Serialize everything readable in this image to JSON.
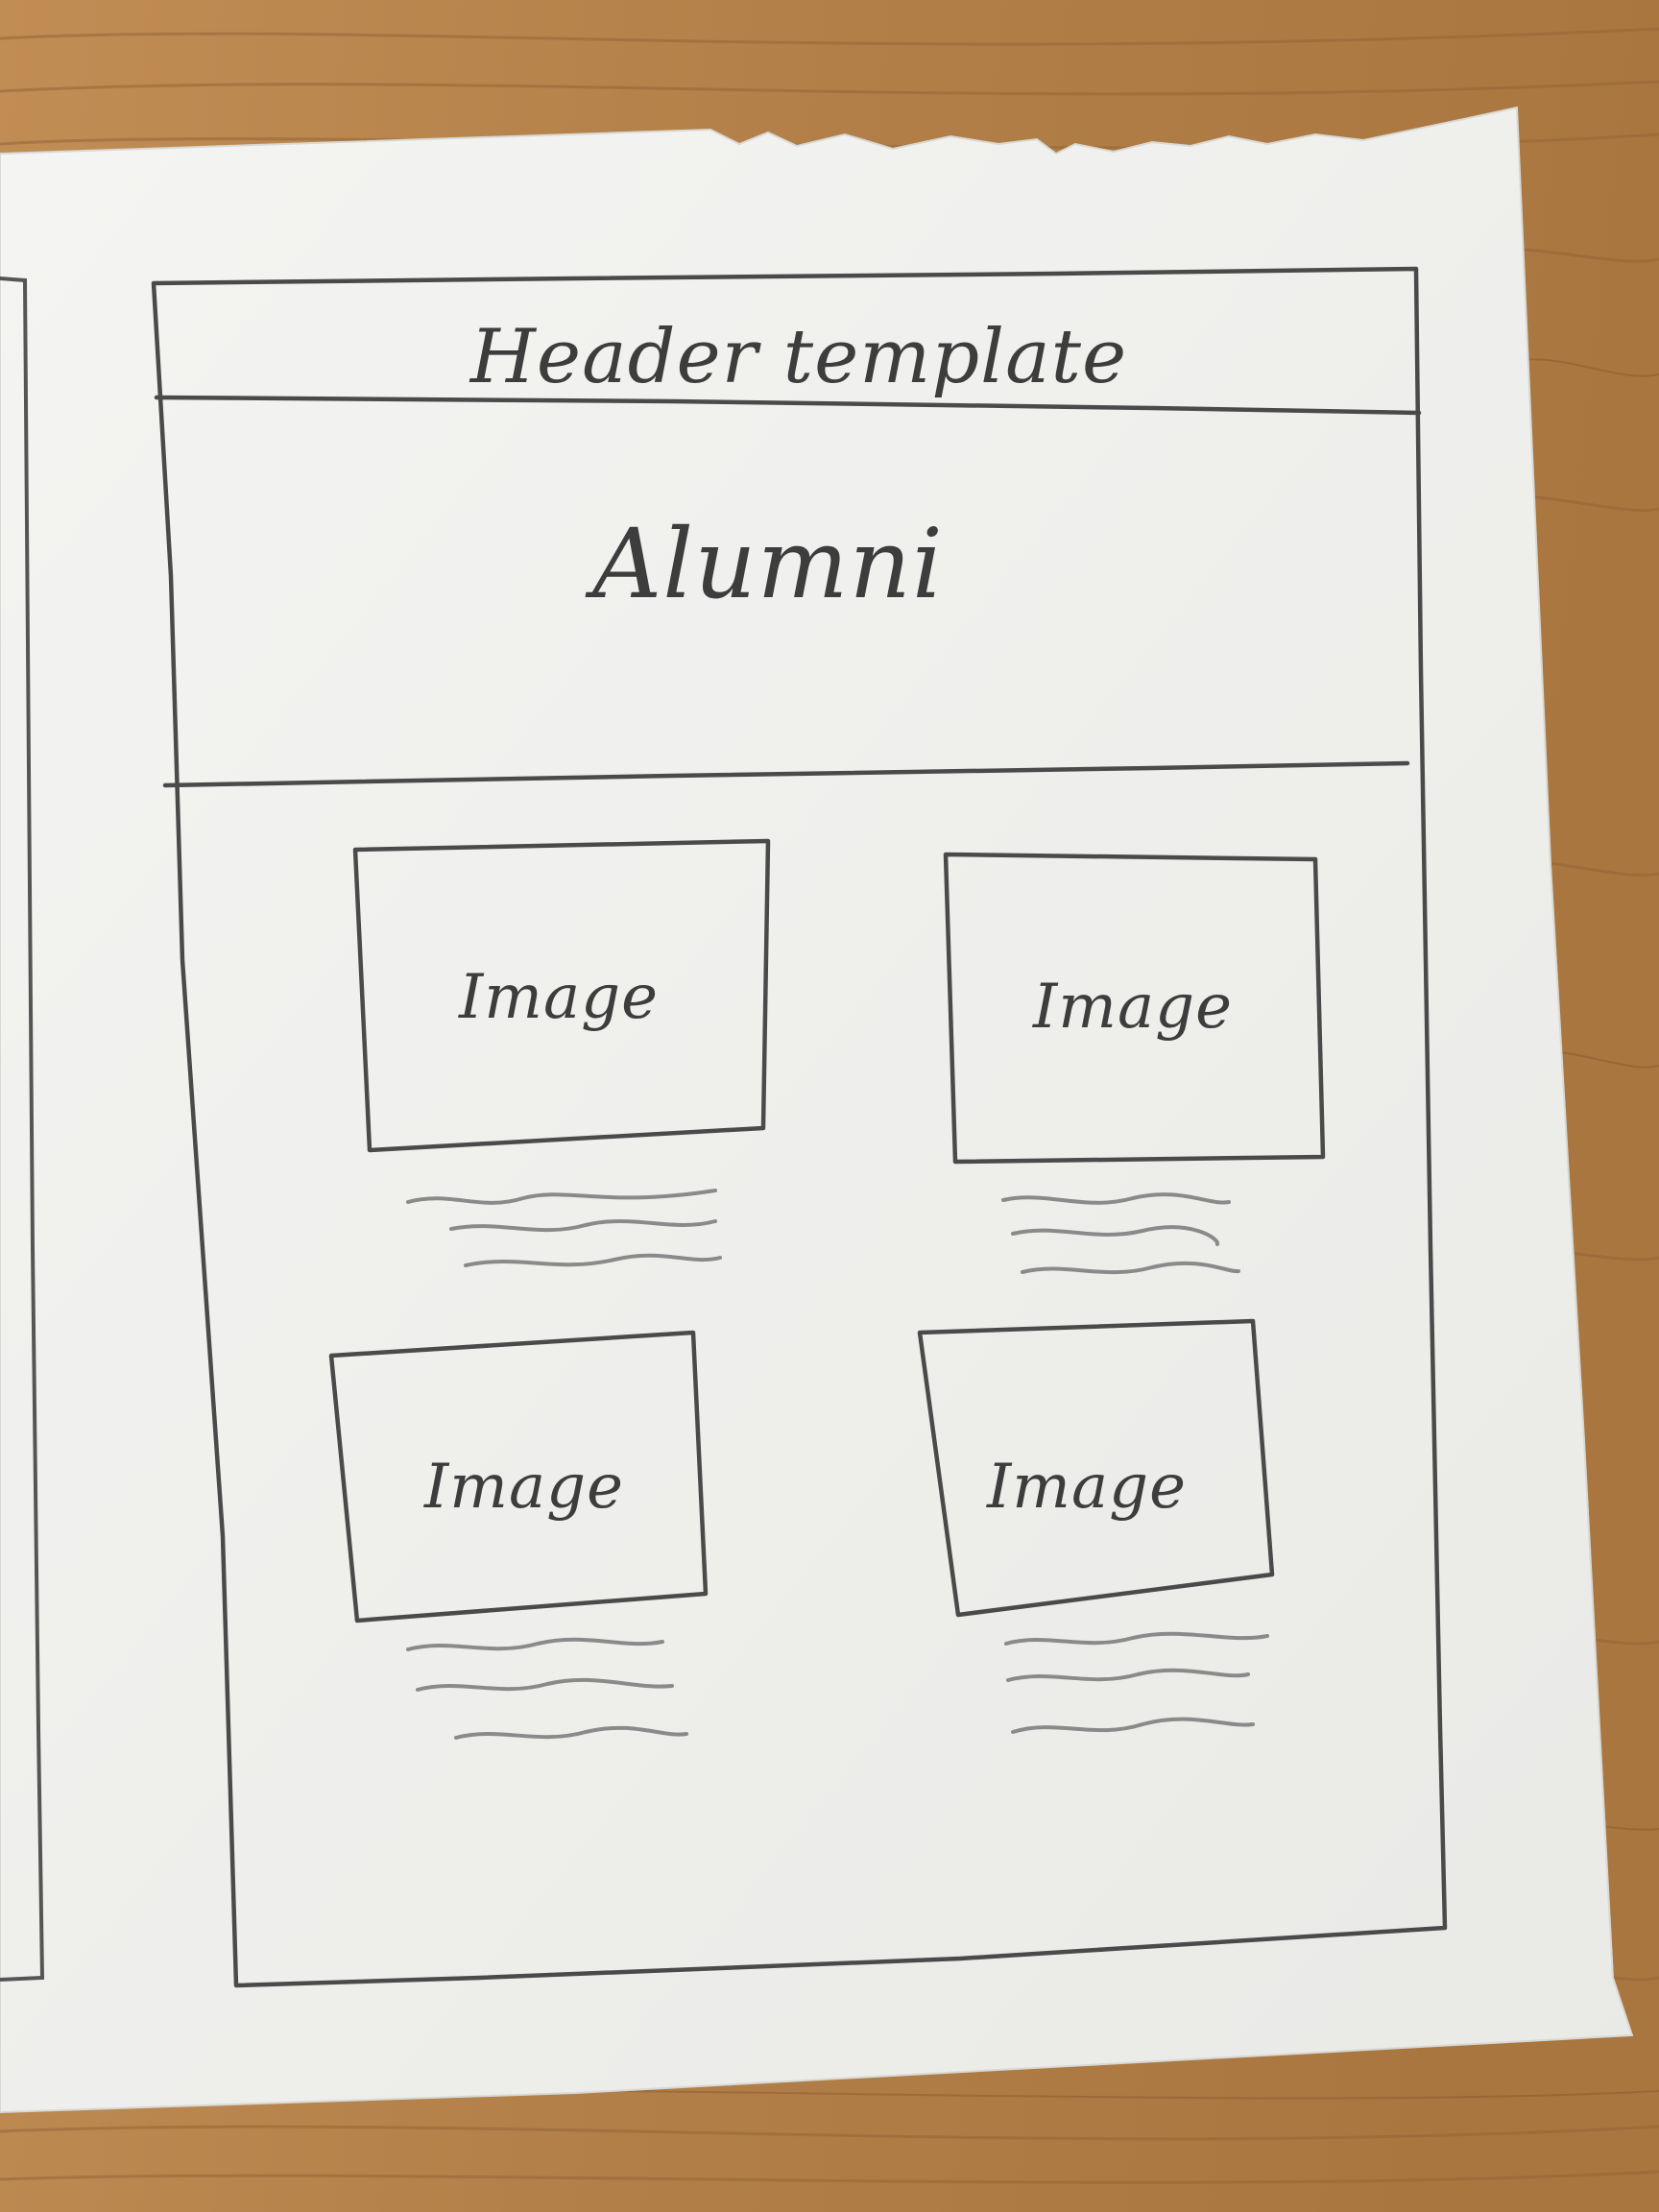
{
  "sketch": {
    "header_label": "Header template",
    "hero_title": "Alumni",
    "cards": [
      {
        "image_label": "Image"
      },
      {
        "image_label": "Image"
      },
      {
        "image_label": "Image"
      },
      {
        "image_label": "Image"
      }
    ]
  },
  "colors": {
    "wood": "#b5834c",
    "wood_dark": "#8f6233",
    "paper": "#f1f1ef",
    "pencil": "#4a4a4a",
    "pencil_light": "#8a8a8a"
  }
}
